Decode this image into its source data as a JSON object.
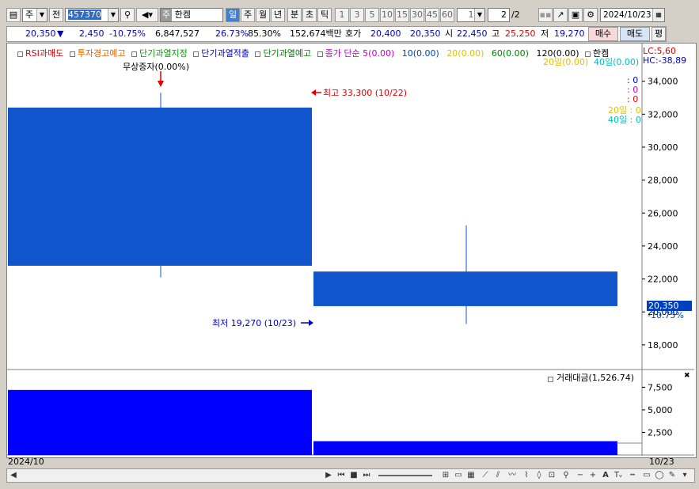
{
  "toolbar": {
    "type_label": "주",
    "prev_label": "전",
    "code": "457370",
    "market_tag": "주",
    "stock_name": "한켐",
    "periods": [
      "일",
      "주",
      "월",
      "년",
      "분",
      "초",
      "틱"
    ],
    "selected_period": "일",
    "intervals": [
      "1",
      "3",
      "5",
      "10",
      "15",
      "30",
      "45",
      "60"
    ],
    "count_value": "1",
    "page_value": "2",
    "page_total": "/2",
    "date": "2024/10/23"
  },
  "info_bar": {
    "price": "20,350",
    "change_arrow": "▼",
    "change": "2,450",
    "change_pct": "-10.75%",
    "volume": "6,847,527",
    "pct1": "26.73%",
    "pct2": "85.30%",
    "amount": "152,674백만",
    "quote_label": "호가",
    "ask": "20,400",
    "bid": "20,350",
    "open_label": "시",
    "open": "22,450",
    "high_label": "고",
    "high": "25,250",
    "low_label": "저",
    "low": "19,270",
    "buy_label": "매수",
    "sell_label": "매도",
    "avg_label": "평"
  },
  "legend": {
    "items": [
      {
        "label": "RSI과매도",
        "color": "#e00000"
      },
      {
        "label": "투자경고예고",
        "color": "#e06000"
      },
      {
        "label": "단기과열지정",
        "color": "#00a000"
      },
      {
        "label": "단기과열적출",
        "color": "#0000c0"
      },
      {
        "label": "단기과열예고",
        "color": "#008000"
      }
    ],
    "ma_text": "종가 단순",
    "ma_items": [
      {
        "label": "5(0.00)",
        "color": "#c000c0"
      },
      {
        "label": "10(0.00)",
        "color": "#0040c0"
      },
      {
        "label": "20(0.00)",
        "color": "#e0c000"
      },
      {
        "label": "60(0.00)",
        "color": "#008000"
      },
      {
        "label": "120(0.00)",
        "color": "#000000"
      }
    ],
    "name": "한켐",
    "lc": "LC:5,60",
    "hc": "HC:-38,89",
    "line2": [
      {
        "label": "20일(0.00)",
        "color": "#e0c000"
      },
      {
        "label": "40일(0.00)",
        "color": "#00c0c0"
      }
    ]
  },
  "right_panel": {
    "v1": ": 0",
    "v2": ": 0",
    "v3": ": 0",
    "v4": "20일 : 0",
    "v5": "40일 : 0"
  },
  "annotations": {
    "bonus": "무상증자(0.00%)",
    "high": "최고 33,300 (10/22)",
    "low": "최저 19,270 (10/23)"
  },
  "price_label": "20,350",
  "pct_label": "-10.75%",
  "volume_title": "거래대금(1,526.74)",
  "x_start": "2024/10",
  "x_end": "10/23",
  "chart_data": {
    "type": "candlestick",
    "categories": [
      "10/22",
      "10/23"
    ],
    "candles": [
      {
        "date": "10/22",
        "open": 32400,
        "close": 22800,
        "high": 33300,
        "low": 22100
      },
      {
        "date": "10/23",
        "open": 22450,
        "close": 20350,
        "high": 25250,
        "low": 19270
      }
    ],
    "ylim": [
      16600,
      34800
    ],
    "yticks": [
      18000,
      20000,
      22000,
      24000,
      26000,
      28000,
      30000,
      32000,
      34000
    ],
    "ytick_labels": [
      "18,000",
      "20,000",
      "22,000",
      "24,000",
      "26,000",
      "28,000",
      "30,000",
      "32,000",
      "34,000"
    ],
    "volume": {
      "title": "거래대금(1,526.74)",
      "values": [
        7200,
        1526.74
      ],
      "ylim": [
        0,
        9200
      ],
      "yticks": [
        2500,
        5000,
        7500
      ],
      "ytick_labels": [
        "2,500",
        "5,000",
        "7,500"
      ]
    },
    "candle_color": "#1155cc",
    "volume_color": "#0000ff"
  }
}
